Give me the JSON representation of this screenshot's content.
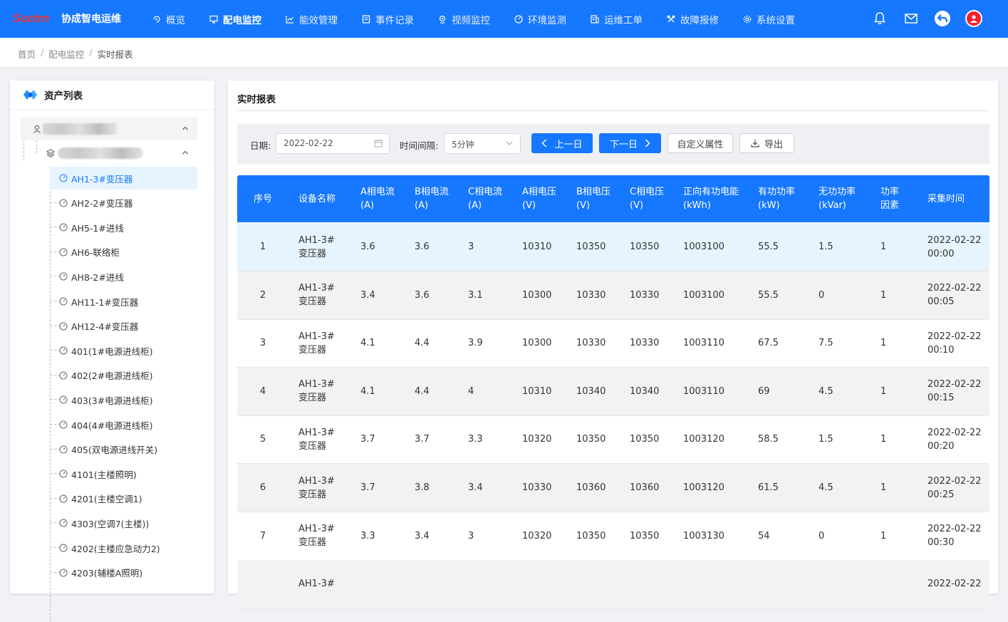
{
  "app": {
    "logo": "Suctrn",
    "title": "协成智电运维"
  },
  "nav": [
    {
      "label": "概览",
      "icon": "overview-icon",
      "active": false
    },
    {
      "label": "配电监控",
      "icon": "monitor-icon",
      "active": true
    },
    {
      "label": "能效管理",
      "icon": "chart-icon",
      "active": false
    },
    {
      "label": "事件记录",
      "icon": "record-icon",
      "active": false
    },
    {
      "label": "视频监控",
      "icon": "camera-icon",
      "active": false
    },
    {
      "label": "环境监测",
      "icon": "gauge-icon",
      "active": false
    },
    {
      "label": "运维工单",
      "icon": "workorder-icon",
      "active": false
    },
    {
      "label": "故障报修",
      "icon": "tools-icon",
      "active": false
    },
    {
      "label": "系统设置",
      "icon": "settings-icon",
      "active": false
    }
  ],
  "breadcrumb": [
    "首页",
    "配电监控",
    "实时报表"
  ],
  "asset_panel": {
    "title": "资产列表",
    "items": [
      "AH1-3#变压器",
      "AH2-2#变压器",
      "AH5-1#进线",
      "AH6-联络柜",
      "AH8-2#进线",
      "AH11-1#变压器",
      "AH12-4#变压器",
      "401(1#电源进线柜)",
      "402(2#电源进线柜)",
      "403(3#电源进线柜)",
      "404(4#电源进线柜)",
      "405(双电源进线开关)",
      "4101(主楼照明)",
      "4201(主楼空调1)",
      "4303(空调7(主楼))",
      "4202(主楼应急动力2)",
      "4203(辅楼A照明)"
    ],
    "selected_index": 0
  },
  "report": {
    "title": "实时报表",
    "date_label": "日期:",
    "date_value": "2022-02-22",
    "interval_label": "时间间隔:",
    "interval_value": "5分钟",
    "prev_label": "上一日",
    "next_label": "下一日",
    "custom_label": "自定义属性",
    "export_label": "导出"
  },
  "table": {
    "headers": [
      "序号",
      "设备名称",
      "A相电流\n(A)",
      "B相电流\n(A)",
      "C相电流\n(A)",
      "A相电压\n(V)",
      "B相电压\n(V)",
      "C相电压\n(V)",
      "正向有功电能\n(kWh)",
      "有功功率\n(kW)",
      "无功功率\n(kVar)",
      "功率\n因素",
      "采集时间"
    ],
    "rows": [
      [
        "1",
        "AH1-3#\n变压器",
        "3.6",
        "3.6",
        "3",
        "10310",
        "10350",
        "10350",
        "1003100",
        "55.5",
        "1.5",
        "1",
        "2022-02-22\n00:00"
      ],
      [
        "2",
        "AH1-3#\n变压器",
        "3.4",
        "3.6",
        "3.1",
        "10300",
        "10330",
        "10330",
        "1003100",
        "55.5",
        "0",
        "1",
        "2022-02-22\n00:05"
      ],
      [
        "3",
        "AH1-3#\n变压器",
        "4.1",
        "4.4",
        "3.9",
        "10300",
        "10330",
        "10330",
        "1003110",
        "67.5",
        "7.5",
        "1",
        "2022-02-22\n00:10"
      ],
      [
        "4",
        "AH1-3#\n变压器",
        "4.1",
        "4.4",
        "4",
        "10310",
        "10340",
        "10340",
        "1003110",
        "69",
        "4.5",
        "1",
        "2022-02-22\n00:15"
      ],
      [
        "5",
        "AH1-3#\n变压器",
        "3.7",
        "3.7",
        "3.3",
        "10320",
        "10350",
        "10350",
        "1003120",
        "58.5",
        "1.5",
        "1",
        "2022-02-22\n00:20"
      ],
      [
        "6",
        "AH1-3#\n变压器",
        "3.7",
        "3.8",
        "3.4",
        "10330",
        "10360",
        "10360",
        "1003120",
        "61.5",
        "4.5",
        "1",
        "2022-02-22\n00:25"
      ],
      [
        "7",
        "AH1-3#\n变压器",
        "3.3",
        "3.4",
        "3",
        "10320",
        "10350",
        "10350",
        "1003130",
        "54",
        "0",
        "1",
        "2022-02-22\n00:30"
      ],
      [
        "",
        "AH1-3#",
        "",
        "",
        "",
        "",
        "",
        "",
        "",
        "",
        "",
        "",
        "2022-02-22"
      ]
    ]
  },
  "colors": {
    "primary": "#1677ff",
    "logo_red": "#e8343a",
    "highlight_row": "#e6f4ff"
  }
}
